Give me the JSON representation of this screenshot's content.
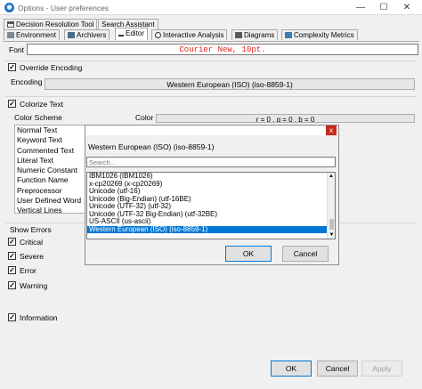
{
  "window": {
    "title": "Options - User preferences",
    "app_icon": "app-icon",
    "minimize": "—",
    "maximize": "☐",
    "close": "✕"
  },
  "tabs_row1": [
    {
      "label": "Decision Resolution Tool",
      "icon": "hierarchy-icon"
    },
    {
      "label": "Search Assistant",
      "icon": ""
    }
  ],
  "tabs_row2": [
    {
      "label": "Environment",
      "icon": "environment-icon"
    },
    {
      "label": "Archivers",
      "icon": "archive-icon"
    },
    {
      "label": "Editor",
      "icon": "editor-icon",
      "active": true
    },
    {
      "label": "Interactive Analysis",
      "icon": "analysis-icon"
    },
    {
      "label": "Diagrams",
      "icon": "diagram-icon"
    },
    {
      "label": "Complexity Metrics",
      "icon": "metrics-icon"
    }
  ],
  "font": {
    "label": "Font",
    "value": "Courier New, 10pt."
  },
  "override_encoding": {
    "label": "Override Encoding",
    "checked": true,
    "encoding_label": "Encoding",
    "encoding_value": "Western European (ISO) (iso-8859-1)"
  },
  "colorize": {
    "label": "Colorize Text",
    "checked": true,
    "scheme_label": "Color Scheme",
    "color_label": "Color",
    "color_value": "r = 0  ,  g = 0  ,  b = 0",
    "items": [
      "Normal Text",
      "Keyword Text",
      "Commented Text",
      "Literal Text",
      "Numeric Constant",
      "Function Name",
      "Preprocessor",
      "User Defined Word",
      "Vertical Lines"
    ]
  },
  "show_errors": {
    "label": "Show Errors",
    "items": [
      {
        "label": "Critical",
        "checked": true
      },
      {
        "label": "Severe",
        "checked": true
      },
      {
        "label": "Error",
        "checked": true
      },
      {
        "label": "Warning",
        "checked": true
      },
      {
        "label": "Information",
        "checked": true
      }
    ]
  },
  "encoding_popup": {
    "close": "x",
    "current": "Western European (ISO) (iso-8859-1)",
    "search_placeholder": "Search...",
    "items": [
      "IBM1026 (IBM1026)",
      "x-cp20269 (x-cp20269)",
      "Unicode (utf-16)",
      "Unicode (Big-Endian) (utf-16BE)",
      "Unicode (UTF-32) (utf-32)",
      "Unicode (UTF-32 Big-Endian) (utf-32BE)",
      "US-ASCII (us-ascii)",
      "Western European (ISO) (iso-8859-1)"
    ],
    "selected_index": 7,
    "ok": "OK",
    "cancel": "Cancel"
  },
  "footer": {
    "ok": "OK",
    "cancel": "Cancel",
    "apply": "Apply"
  },
  "colors": {
    "accent": "#0078d7",
    "font_preview": "#e0261b",
    "close_red": "#c42b1c"
  }
}
